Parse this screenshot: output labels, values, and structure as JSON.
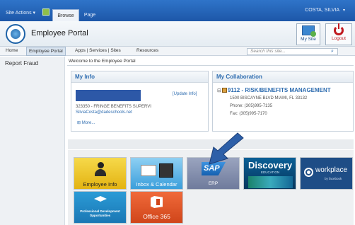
{
  "ribbon": {
    "site_actions": "Site Actions ▾",
    "tabs": [
      "Browse",
      "Page"
    ],
    "user": "COSTA, SILVIA"
  },
  "header": {
    "title": "Employee Portal",
    "my_site": "My Site",
    "logout": "Logout"
  },
  "nav": {
    "items": [
      "Home",
      "Employee Portal",
      "Apps | Services | Sites",
      "Resources"
    ],
    "search_placeholder": "Search this site..."
  },
  "left_nav": {
    "items": [
      "Report Fraud"
    ]
  },
  "main": {
    "welcome": "Welcome to the Employee Portal",
    "my_info": {
      "title": "My Info",
      "update_link": "[Update Info]",
      "line1": "323350 - FRINGE BENEFITS SUPERVI",
      "email": "SilviaCosta@dadeschools.net",
      "more": "More..."
    },
    "my_collaboration": {
      "title": "My Collaboration",
      "location": "9112 - RISK/BENEFITS MANAGEMENT",
      "address": "1500 BISCAYNE BLVD MIAMI, FL 33132",
      "phone": "Phone: (305)995-7135",
      "fax": "Fax: (305)995-7170"
    }
  },
  "apps": [
    {
      "label": "Employee Info",
      "icon": "person-icon"
    },
    {
      "label": "Inbox & Calendar",
      "icon": "envelope-calendar-icon"
    },
    {
      "label": "SAP",
      "sub": "ERP",
      "icon": "sap-logo"
    },
    {
      "label": "Discovery",
      "sub": "EDUCATION",
      "icon": "discovery-logo"
    },
    {
      "label": "workplace",
      "sub": "by facebook",
      "icon": "workplace-logo"
    },
    {
      "label": "Professional Development Opportunities",
      "icon": "graduation-cap-icon"
    },
    {
      "label": "Office 365",
      "icon": "office-logo"
    }
  ],
  "colors": {
    "ribbon": "#2f74c9",
    "link": "#2f6db0",
    "arrow": "#2d5fa8"
  }
}
